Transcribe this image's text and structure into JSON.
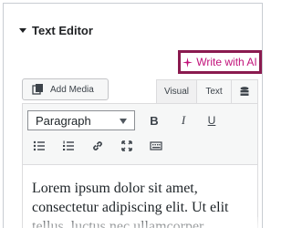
{
  "section": {
    "title": "Text Editor"
  },
  "ai": {
    "label": "Write with AI",
    "color": "#c2127a",
    "border_color": "#8a1a4f"
  },
  "media": {
    "label": "Add Media"
  },
  "tabs": {
    "visual": "Visual",
    "text": "Text"
  },
  "toolbar": {
    "format": {
      "selected": "Paragraph"
    },
    "bold": "B",
    "italic": "I",
    "underline": "U"
  },
  "content": {
    "text": "Lorem ipsum dolor sit amet, consectetur adipiscing elit. Ut elit tellus, luctus nec ullamcorper"
  }
}
